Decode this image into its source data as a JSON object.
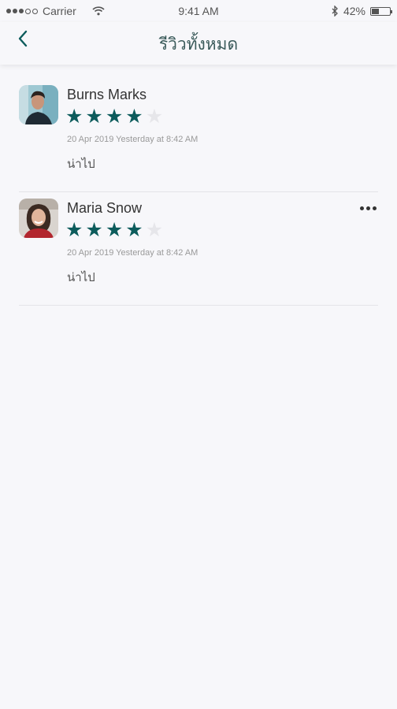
{
  "status_bar": {
    "carrier": "Carrier",
    "time": "9:41 AM",
    "battery_percent": "42%",
    "battery_level": 0.42,
    "icons": [
      "signal-dots-icon",
      "wifi-icon",
      "bluetooth-icon",
      "battery-icon"
    ]
  },
  "nav": {
    "title": "รีวิวทั้งหมด",
    "back_icon": "chevron-left-icon"
  },
  "reviews": [
    {
      "name": "Burns Marks",
      "rating": 4,
      "max_rating": 5,
      "date": "20 Apr 2019 Yesterday at 8:42 AM",
      "comment": "น่าไป",
      "has_more_menu": false
    },
    {
      "name": "Maria Snow",
      "rating": 4,
      "max_rating": 5,
      "date": "20 Apr 2019 Yesterday at 8:42 AM",
      "comment": "น่าไป",
      "has_more_menu": true
    }
  ],
  "colors": {
    "accent": "#0d5c5c",
    "star_off": "#e6e6ea",
    "background": "#f7f7fa",
    "title": "#3a5a5a"
  }
}
